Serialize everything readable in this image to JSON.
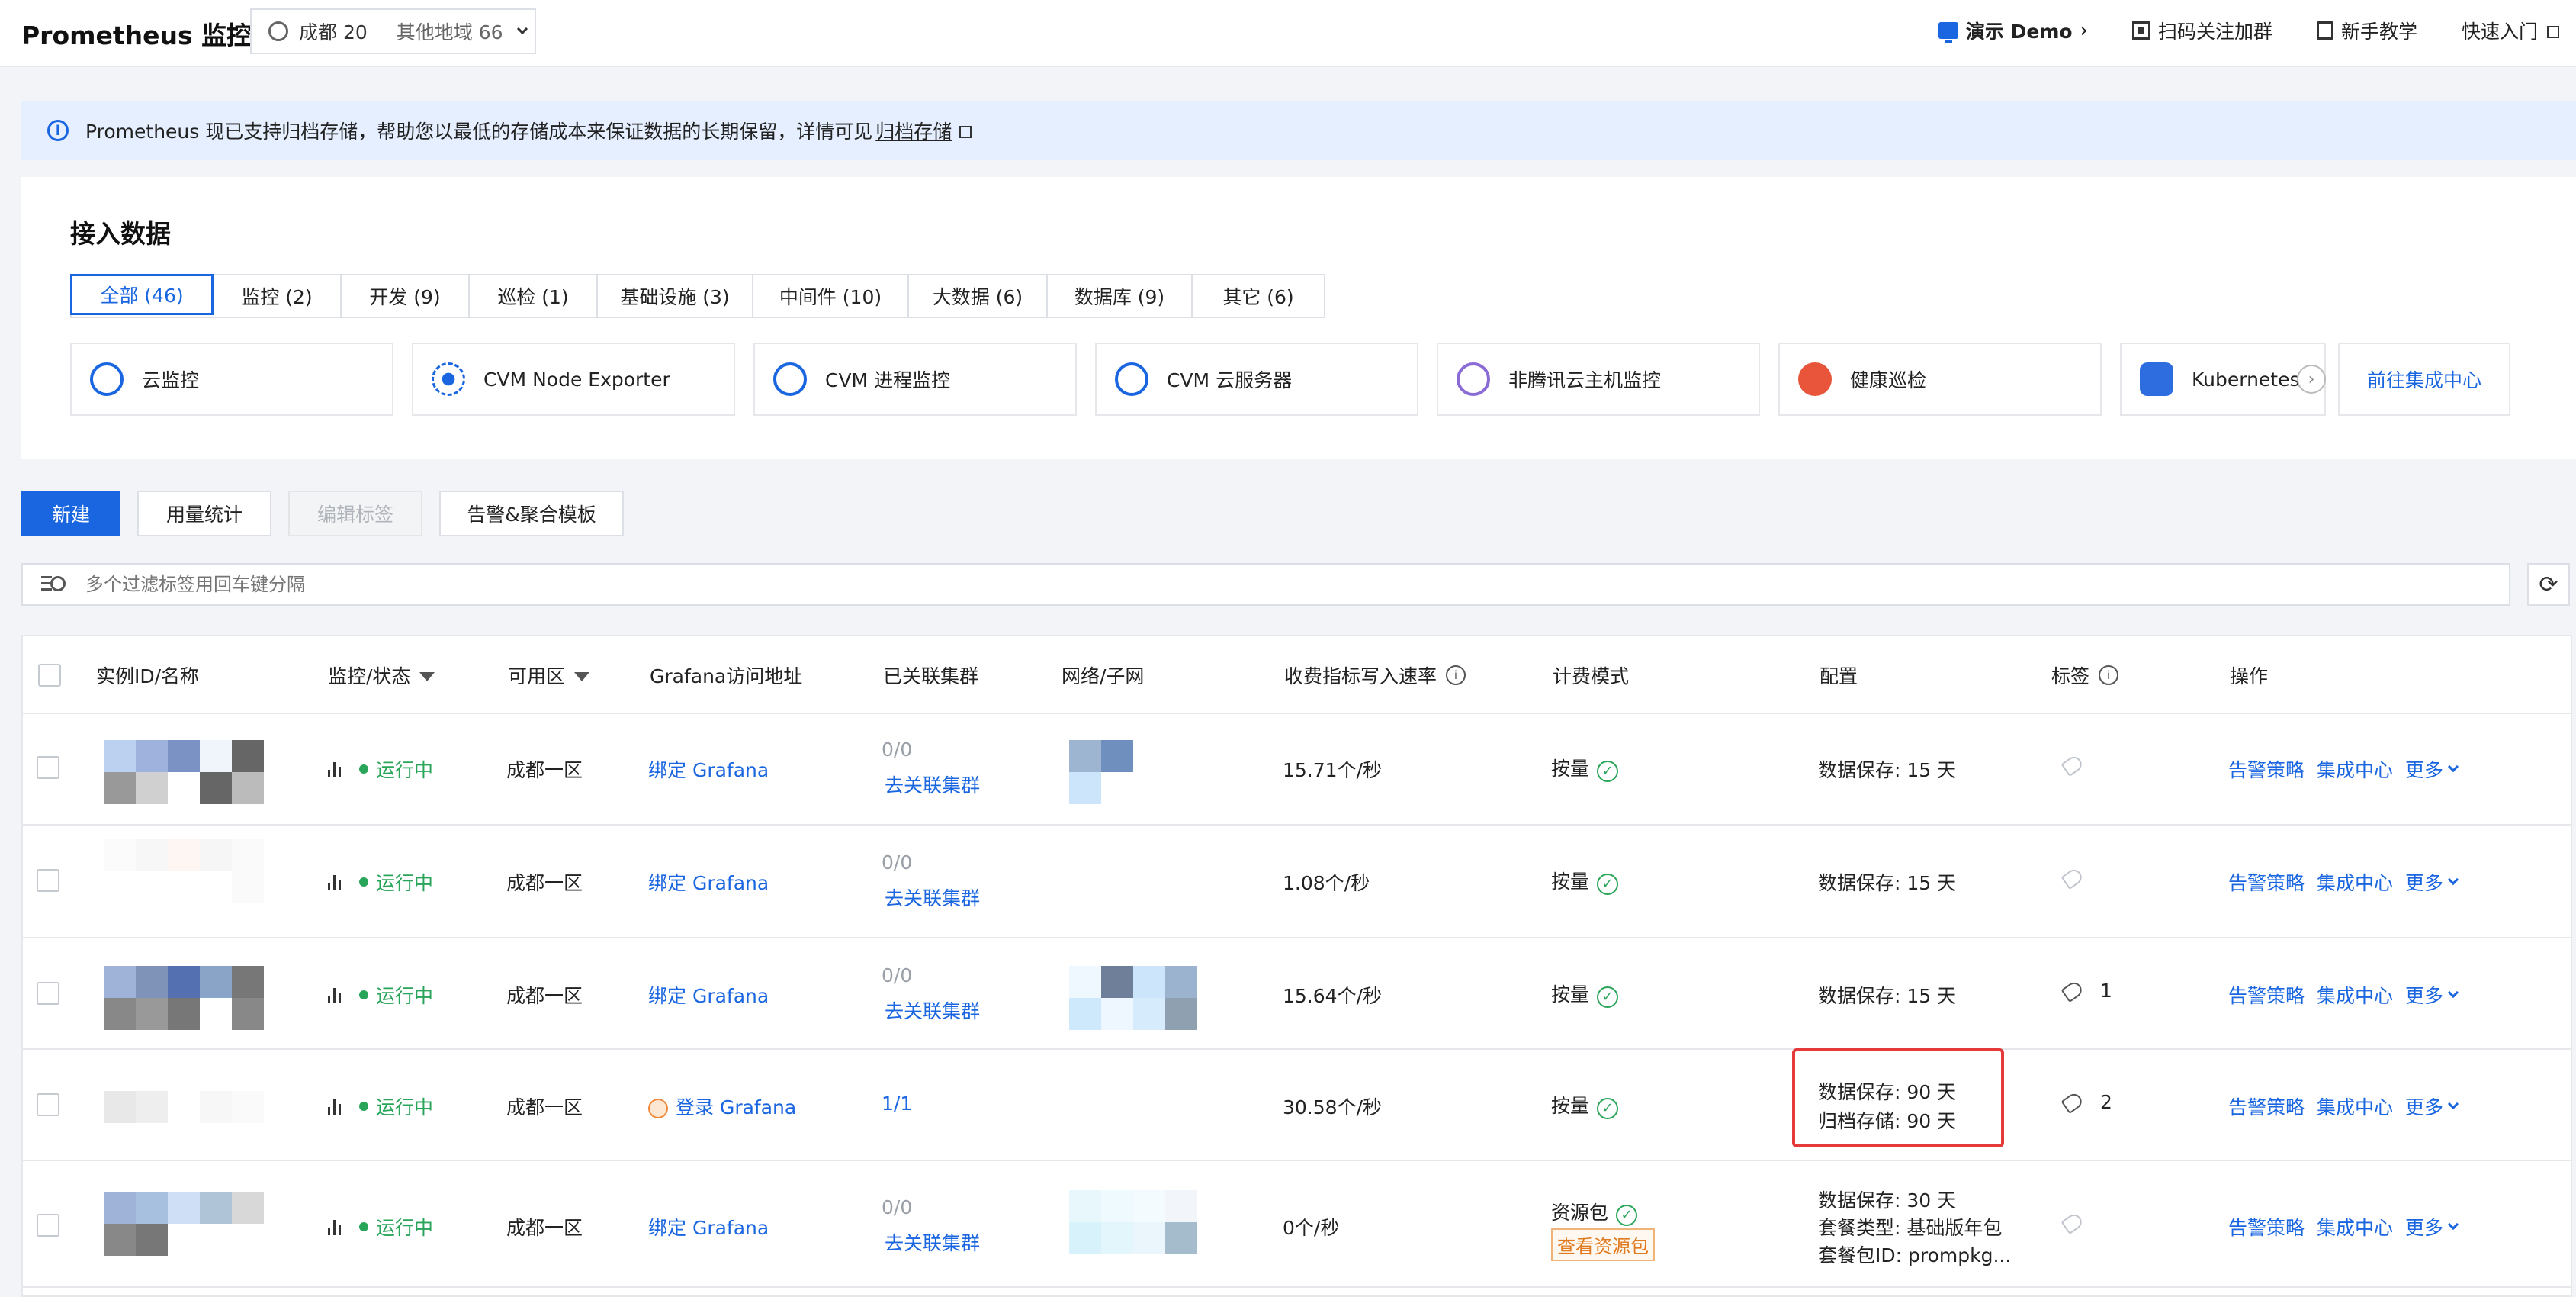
{
  "topbar": {
    "title": "Prometheus 监控",
    "region": "成都 20",
    "other_regions": "其他地域 66",
    "demo": "演示 Demo",
    "scan": "扫码关注加群",
    "tutorial": "新手教学",
    "quickstart": "快速入门"
  },
  "notice": {
    "text": "Prometheus 现已支持归档存储，帮助您以最低的存储成本来保证数据的长期保留，详情可见",
    "link": "归档存储"
  },
  "access": {
    "title": "接入数据",
    "tabs": [
      {
        "label": "全部 (46)"
      },
      {
        "label": "监控 (2)"
      },
      {
        "label": "开发 (9)"
      },
      {
        "label": "巡检 (1)"
      },
      {
        "label": "基础设施 (3)"
      },
      {
        "label": "中间件 (10)"
      },
      {
        "label": "大数据 (6)"
      },
      {
        "label": "数据库 (9)"
      },
      {
        "label": "其它 (6)"
      }
    ],
    "integrations": [
      {
        "label": "云监控",
        "icon": "cloud-monitor-icon"
      },
      {
        "label": "CVM Node Exporter",
        "icon": "node-exporter-icon"
      },
      {
        "label": "CVM 进程监控",
        "icon": "process-monitor-icon"
      },
      {
        "label": "CVM 云服务器",
        "icon": "cvm-server-icon"
      },
      {
        "label": "非腾讯云主机监控",
        "icon": "external-host-icon"
      },
      {
        "label": "健康巡检",
        "icon": "health-check-icon"
      },
      {
        "label": "Kubernetes",
        "icon": "kubernetes-icon"
      }
    ],
    "goto": "前往集成中心"
  },
  "actions": {
    "new": "新建",
    "usage": "用量统计",
    "edit_tags": "编辑标签",
    "alert_templates": "告警&聚合模板"
  },
  "filter": {
    "placeholder": "多个过滤标签用回车键分隔"
  },
  "table": {
    "headers": {
      "id": "实例ID/名称",
      "status": "监控/状态",
      "zone": "可用区",
      "grafana": "Grafana访问地址",
      "clusters": "已关联集群",
      "network": "网络/子网",
      "rate": "收费指标写入速率",
      "billing": "计费模式",
      "config": "配置",
      "tags": "标签",
      "ops": "操作"
    },
    "rows": [
      {
        "status": "运行中",
        "zone": "成都一区",
        "grafana": "绑定 Grafana",
        "clusters_count": "0/0",
        "clusters_action": "去关联集群",
        "rate": "15.71个/秒",
        "billing": "按量",
        "config1": "数据保存: 15 天",
        "tag_count": ""
      },
      {
        "status": "运行中",
        "zone": "成都一区",
        "grafana": "绑定 Grafana",
        "clusters_count": "0/0",
        "clusters_action": "去关联集群",
        "rate": "1.08个/秒",
        "billing": "按量",
        "config1": "数据保存: 15 天",
        "tag_count": ""
      },
      {
        "status": "运行中",
        "zone": "成都一区",
        "grafana": "绑定 Grafana",
        "clusters_count": "0/0",
        "clusters_action": "去关联集群",
        "rate": "15.64个/秒",
        "billing": "按量",
        "config1": "数据保存: 15 天",
        "tag_count": "1"
      },
      {
        "status": "运行中",
        "zone": "成都一区",
        "grafana": "登录 Grafana",
        "clusters_count": "1/1",
        "clusters_action": "",
        "rate": "30.58个/秒",
        "billing": "按量",
        "config1": "数据保存: 90 天",
        "config2": "归档存储:  90 天",
        "tag_count": "2"
      },
      {
        "status": "运行中",
        "zone": "成都一区",
        "grafana": "绑定 Grafana",
        "clusters_count": "0/0",
        "clusters_action": "去关联集群",
        "rate": "0个/秒",
        "billing": "资源包",
        "billing_action": "查看资源包",
        "config1": "数据保存: 30 天",
        "config2": "套餐类型: 基础版年包",
        "config3": "套餐包ID:  prompkg...",
        "tag_count": ""
      }
    ],
    "ops": {
      "alert": "告警策略",
      "integration": "集成中心",
      "more": "更多"
    }
  },
  "colors": {
    "primary": "#1a66e0",
    "success": "#29a55a",
    "highlight": "#e53a3a"
  }
}
